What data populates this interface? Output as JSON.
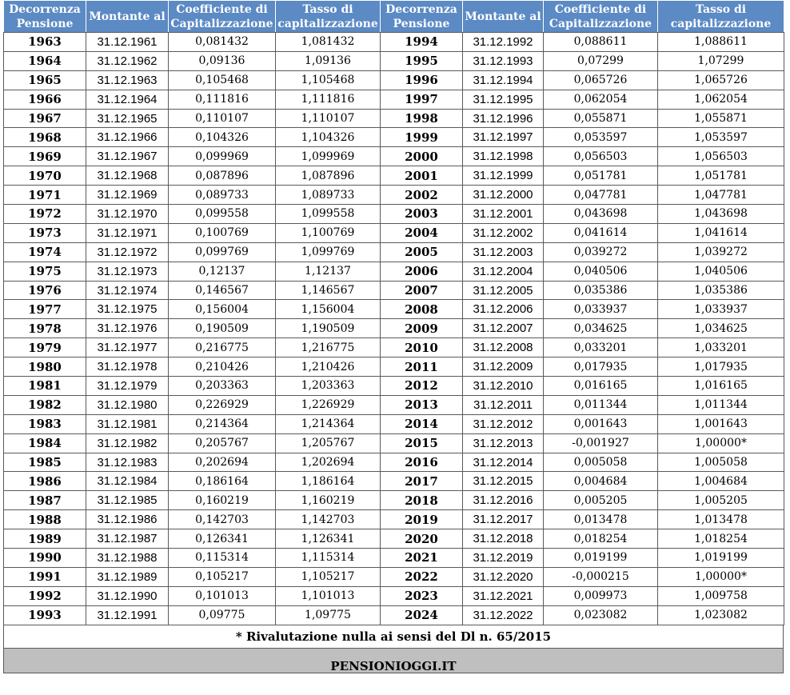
{
  "headers": [
    [
      "Decorrenza",
      "Pensione"
    ],
    [
      "Montante al",
      ""
    ],
    [
      "Coefficiente di",
      "Capitalizzazione"
    ],
    [
      "Tasso di",
      "capitalizzazione"
    ],
    [
      "Decorrenza",
      "Pensione"
    ],
    [
      "Montante al",
      ""
    ],
    [
      "Coefficiente di",
      "Capitalizzazione"
    ],
    [
      "Tasso di",
      "capitalizzazione"
    ]
  ],
  "rows": [
    [
      "1963",
      "31.12.1961",
      "0,081432",
      "1,081432",
      "1994",
      "31.12.1992",
      "0,088611",
      "1,088611"
    ],
    [
      "1964",
      "31.12.1962",
      "0,09136",
      "1,09136",
      "1995",
      "31.12.1993",
      "0,07299",
      "1,07299"
    ],
    [
      "1965",
      "31.12.1963",
      "0,105468",
      "1,105468",
      "1996",
      "31.12.1994",
      "0,065726",
      "1,065726"
    ],
    [
      "1966",
      "31.12.1964",
      "0,111816",
      "1,111816",
      "1997",
      "31.12.1995",
      "0,062054",
      "1,062054"
    ],
    [
      "1967",
      "31.12.1965",
      "0,110107",
      "1,110107",
      "1998",
      "31.12.1996",
      "0,055871",
      "1,055871"
    ],
    [
      "1968",
      "31.12.1966",
      "0,104326",
      "1,104326",
      "1999",
      "31.12.1997",
      "0,053597",
      "1,053597"
    ],
    [
      "1969",
      "31.12.1967",
      "0,099969",
      "1,099969",
      "2000",
      "31.12.1998",
      "0,056503",
      "1,056503"
    ],
    [
      "1970",
      "31.12.1968",
      "0,087896",
      "1,087896",
      "2001",
      "31.12.1999",
      "0,051781",
      "1,051781"
    ],
    [
      "1971",
      "31.12.1969",
      "0,089733",
      "1,089733",
      "2002",
      "31.12.2000",
      "0,047781",
      "1,047781"
    ],
    [
      "1972",
      "31.12.1970",
      "0,099558",
      "1,099558",
      "2003",
      "31.12.2001",
      "0,043698",
      "1,043698"
    ],
    [
      "1973",
      "31.12.1971",
      "0,100769",
      "1,100769",
      "2004",
      "31.12.2002",
      "0,041614",
      "1,041614"
    ],
    [
      "1974",
      "31.12.1972",
      "0,099769",
      "1,099769",
      "2005",
      "31.12.2003",
      "0,039272",
      "1,039272"
    ],
    [
      "1975",
      "31.12.1973",
      "0,12137",
      "1,12137",
      "2006",
      "31.12.2004",
      "0,040506",
      "1,040506"
    ],
    [
      "1976",
      "31.12.1974",
      "0,146567",
      "1,146567",
      "2007",
      "31.12.2005",
      "0,035386",
      "1,035386"
    ],
    [
      "1977",
      "31.12.1975",
      "0,156004",
      "1,156004",
      "2008",
      "31.12.2006",
      "0,033937",
      "1,033937"
    ],
    [
      "1978",
      "31.12.1976",
      "0,190509",
      "1,190509",
      "2009",
      "31.12.2007",
      "0,034625",
      "1,034625"
    ],
    [
      "1979",
      "31.12.1977",
      "0,216775",
      "1,216775",
      "2010",
      "31.12.2008",
      "0,033201",
      "1,033201"
    ],
    [
      "1980",
      "31.12.1978",
      "0,210426",
      "1,210426",
      "2011",
      "31.12.2009",
      "0,017935",
      "1,017935"
    ],
    [
      "1981",
      "31.12.1979",
      "0,203363",
      "1,203363",
      "2012",
      "31.12.2010",
      "0,016165",
      "1,016165"
    ],
    [
      "1982",
      "31.12.1980",
      "0,226929",
      "1,226929",
      "2013",
      "31.12.2011",
      "0,011344",
      "1,011344"
    ],
    [
      "1983",
      "31.12.1981",
      "0,214364",
      "1,214364",
      "2014",
      "31.12.2012",
      "0,001643",
      "1,001643"
    ],
    [
      "1984",
      "31.12.1982",
      "0,205767",
      "1,205767",
      "2015",
      "31.12.2013",
      "-0,001927",
      "1,00000*"
    ],
    [
      "1985",
      "31.12.1983",
      "0,202694",
      "1,202694",
      "2016",
      "31.12.2014",
      "0,005058",
      "1,005058"
    ],
    [
      "1986",
      "31.12.1984",
      "0,186164",
      "1,186164",
      "2017",
      "31.12.2015",
      "0,004684",
      "1,004684"
    ],
    [
      "1987",
      "31.12.1985",
      "0,160219",
      "1,160219",
      "2018",
      "31.12.2016",
      "0,005205",
      "1,005205"
    ],
    [
      "1988",
      "31.12.1986",
      "0,142703",
      "1,142703",
      "2019",
      "31.12.2017",
      "0,013478",
      "1,013478"
    ],
    [
      "1989",
      "31.12.1987",
      "0,126341",
      "1,126341",
      "2020",
      "31.12.2018",
      "0,018254",
      "1,018254"
    ],
    [
      "1990",
      "31.12.1988",
      "0,115314",
      "1,115314",
      "2021",
      "31.12.2019",
      "0,019199",
      "1,019199"
    ],
    [
      "1991",
      "31.12.1989",
      "0,105217",
      "1,105217",
      "2022",
      "31.12.2020",
      "-0,000215",
      "1,00000*"
    ],
    [
      "1992",
      "31.12.1990",
      "0,101013",
      "1,101013",
      "2023",
      "31.12.2021",
      "0,009973",
      "1,009758"
    ],
    [
      "1993",
      "31.12.1991",
      "0,09775",
      "1,09775",
      "2024",
      "31.12.2022",
      "0,023082",
      "1,023082"
    ]
  ],
  "note": "* Rivalutazione nulla ai sensi del Dl n. 65/2015",
  "footer": "PENSIONIOGGI.IT",
  "colors": {
    "header_bg": "#5b8ac4",
    "footer_bg": "#bfbfbf"
  }
}
